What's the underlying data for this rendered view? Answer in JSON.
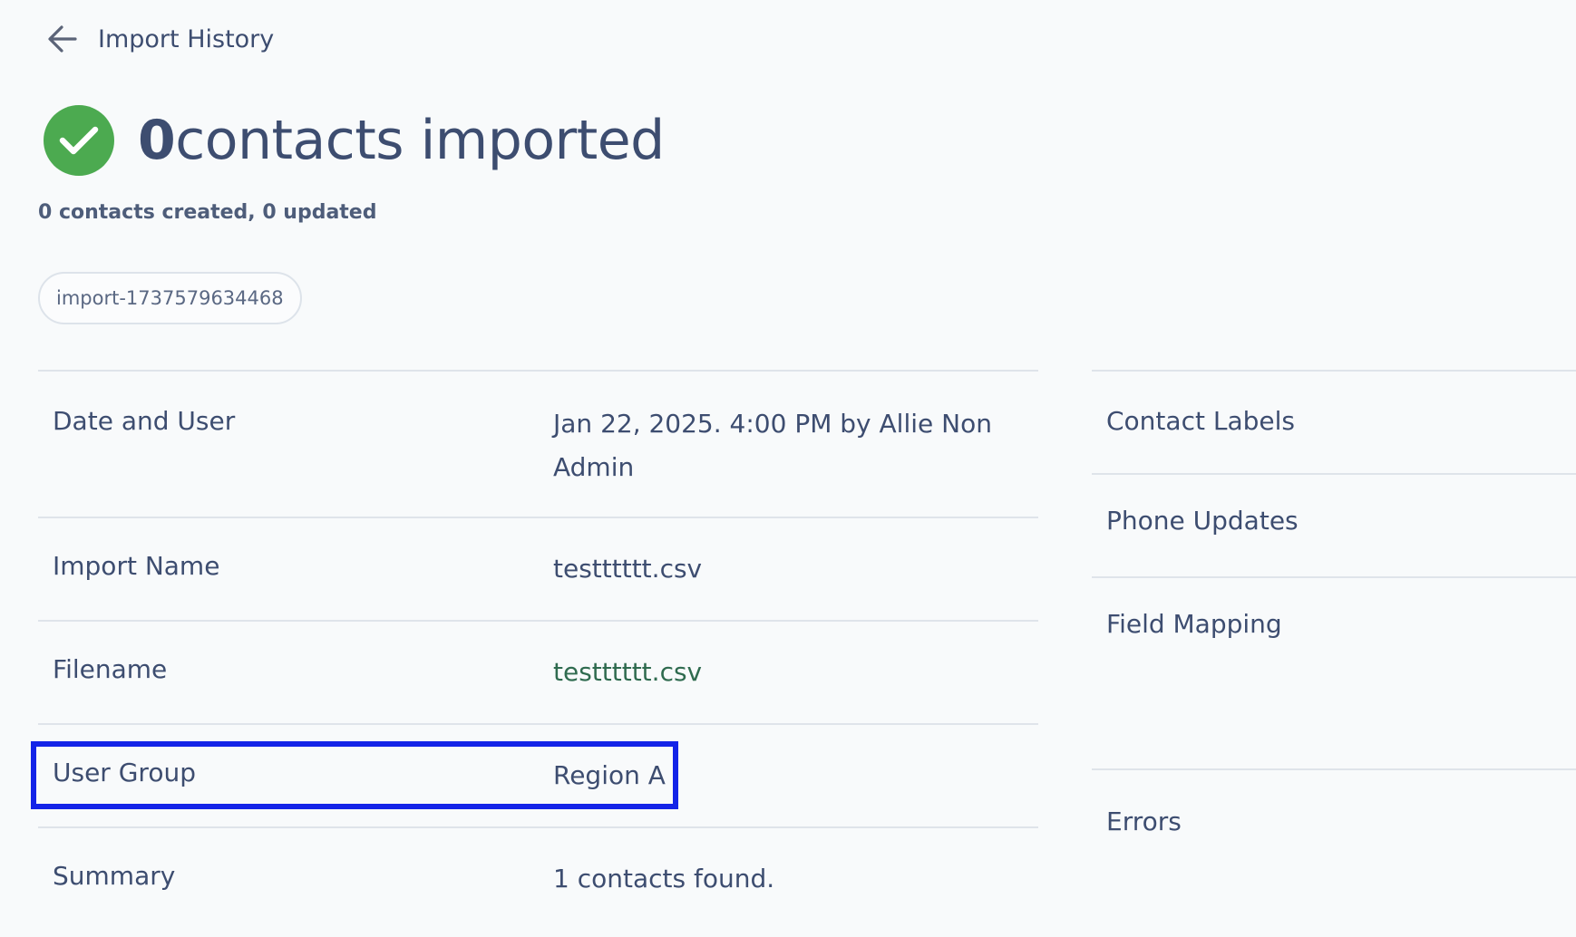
{
  "back": {
    "label": "Import History"
  },
  "headline": {
    "count": "0",
    "text": "contacts imported"
  },
  "subline": "0 contacts created, 0 updated",
  "import_id": "import-1737579634468",
  "details": {
    "date_and_user": {
      "label": "Date and User",
      "value": "Jan 22, 2025. 4:00 PM by Allie Non Admin"
    },
    "import_name": {
      "label": "Import Name",
      "value": "testttttt.csv"
    },
    "filename": {
      "label": "Filename",
      "value": "testttttt.csv"
    },
    "user_group": {
      "label": "User Group",
      "value": "Region A"
    },
    "summary": {
      "label": "Summary",
      "value": "1 contacts found."
    }
  },
  "side_panel": {
    "contact_labels": "Contact Labels",
    "phone_updates": "Phone Updates",
    "field_mapping": "Field Mapping",
    "errors": "Errors"
  },
  "colors": {
    "background": "#f8fafb",
    "text": "#3d4d70",
    "success": "#4caa50",
    "link": "#2f6b4f",
    "highlight": "#1424e8",
    "divider": "#dfe4ea"
  },
  "icons": {
    "back": "arrow-left-icon",
    "status": "check-circle-icon"
  }
}
